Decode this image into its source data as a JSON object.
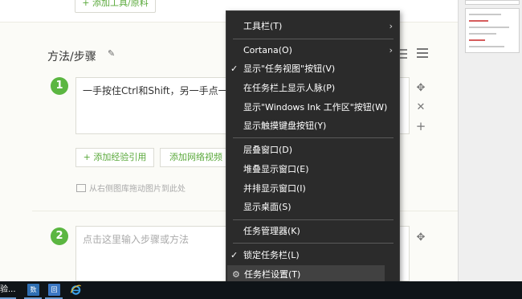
{
  "editor": {
    "add_tool_label": "+ 添加工具/原料",
    "section_title": "方法/步骤",
    "steps": [
      {
        "number": "1",
        "text": "一手按住Ctrl和Shift，另一手点一下"
      },
      {
        "number": "2",
        "placeholder": "点击这里输入步骤或方法"
      }
    ],
    "add_reference_label": "+ 添加经验引用",
    "add_web_video_label": "添加网络视频",
    "image_hint": "从右侧图库拖动图片到此处"
  },
  "context_menu": {
    "items": [
      {
        "label": "工具栏(T)",
        "submenu": true
      },
      {
        "label": "Cortana(O)",
        "submenu": true
      },
      {
        "label": "显示\"任务视图\"按钮(V)",
        "checked": true
      },
      {
        "label": "在任务栏上显示人脉(P)"
      },
      {
        "label": "显示\"Windows Ink 工作区\"按钮(W)"
      },
      {
        "label": "显示触摸键盘按钮(Y)"
      },
      {
        "label": "层叠窗口(D)"
      },
      {
        "label": "堆叠显示窗口(E)"
      },
      {
        "label": "并排显示窗口(I)"
      },
      {
        "label": "显示桌面(S)"
      },
      {
        "label": "任务管理器(K)"
      },
      {
        "label": "锁定任务栏(L)",
        "checked": true
      },
      {
        "label": "任务栏设置(T)",
        "icon": "gear-icon",
        "highlighted": true
      }
    ],
    "check_glyph": "✓",
    "arrow_glyph": "›",
    "gear_glyph": "⚙"
  },
  "taskbar": {
    "truncated_label": "验...",
    "app1_label": "数",
    "app2_label": "回",
    "app3_icon": "ie-icon"
  },
  "colors": {
    "accent_green": "#5bb641",
    "menu_bg": "#2b2b2b",
    "taskbar_bg": "#0f1418"
  }
}
